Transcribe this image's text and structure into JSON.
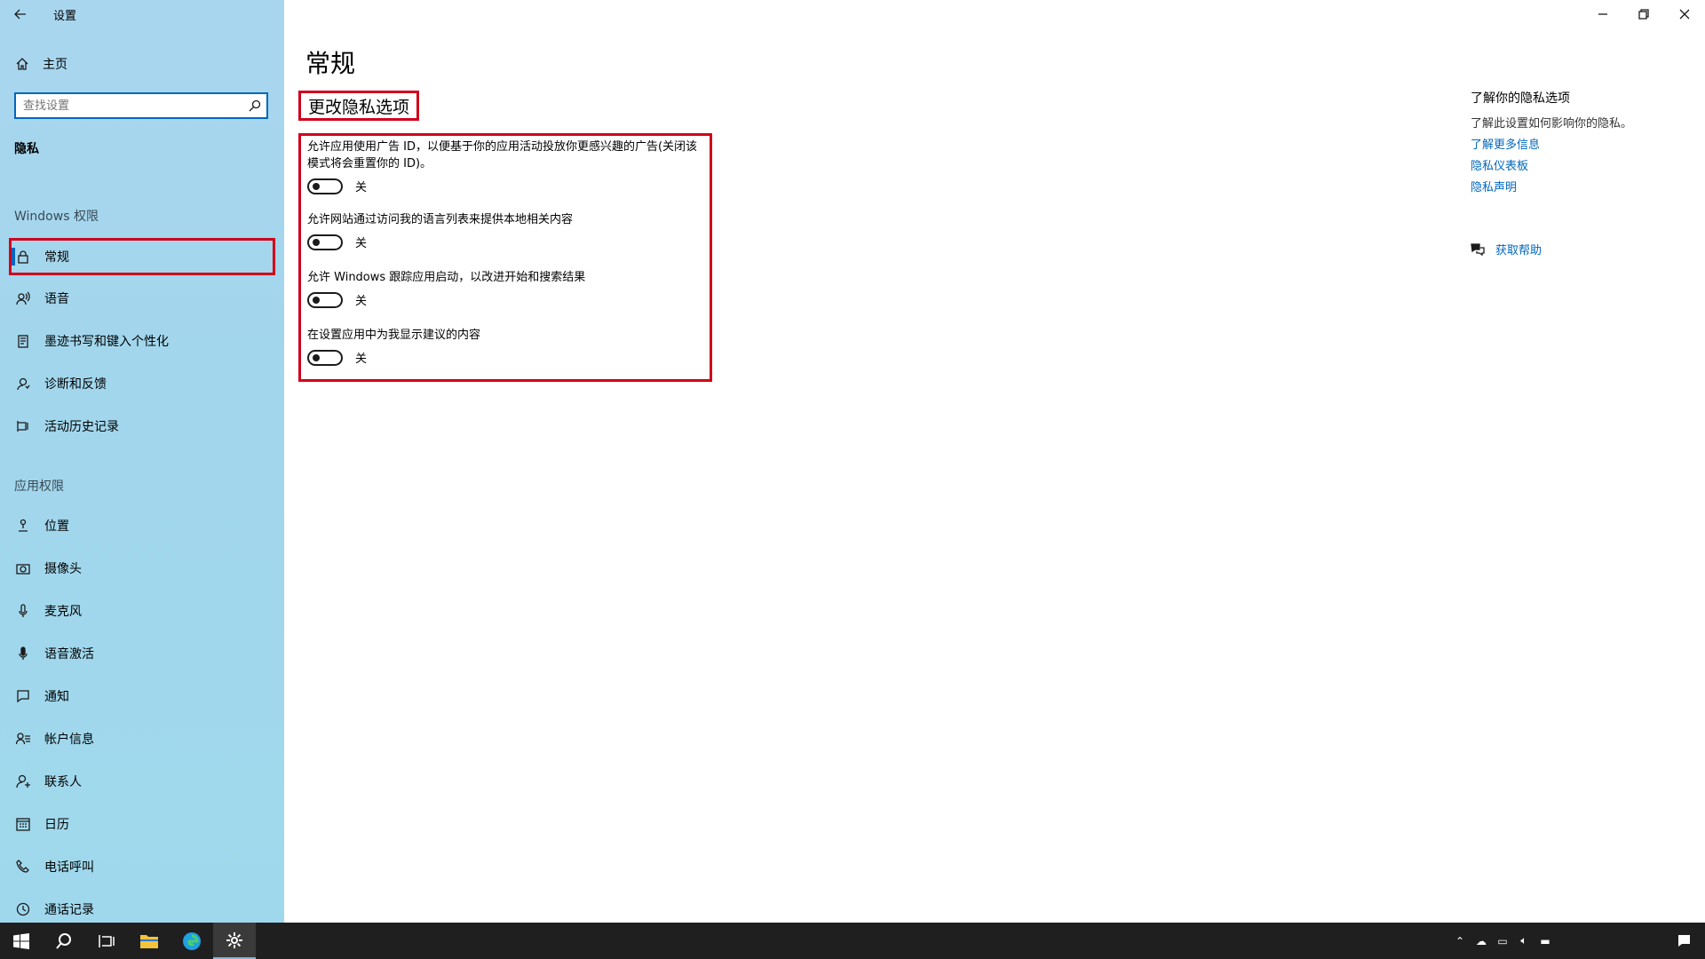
{
  "window": {
    "title": "设置",
    "accent": "#0067c0",
    "highlight": "#d0021b"
  },
  "sidebar": {
    "home_label": "主页",
    "search_placeholder": "查找设置",
    "section_label": "隐私",
    "groups": [
      {
        "title": "Windows 权限"
      },
      {
        "title": "应用权限"
      }
    ],
    "windows_items": [
      {
        "label": "常规",
        "icon": "lock-icon",
        "selected": true
      },
      {
        "label": "语音",
        "icon": "speech-icon"
      },
      {
        "label": "墨迹书写和键入个性化",
        "icon": "ink-icon"
      },
      {
        "label": "诊断和反馈",
        "icon": "feedback-icon"
      },
      {
        "label": "活动历史记录",
        "icon": "history-icon"
      }
    ],
    "app_items": [
      {
        "label": "位置",
        "icon": "location-icon"
      },
      {
        "label": "摄像头",
        "icon": "camera-icon"
      },
      {
        "label": "麦克风",
        "icon": "microphone-icon"
      },
      {
        "label": "语音激活",
        "icon": "voice-activation-icon"
      },
      {
        "label": "通知",
        "icon": "notification-icon"
      },
      {
        "label": "帐户信息",
        "icon": "account-icon"
      },
      {
        "label": "联系人",
        "icon": "contacts-icon"
      },
      {
        "label": "日历",
        "icon": "calendar-icon"
      },
      {
        "label": "电话呼叫",
        "icon": "phone-icon"
      },
      {
        "label": "通话记录",
        "icon": "call-history-icon"
      }
    ]
  },
  "main": {
    "page_title": "常规",
    "subtitle": "更改隐私选项",
    "options": [
      {
        "desc": "允许应用使用广告 ID，以便基于你的应用活动投放你更感兴趣的广告(关闭该模式将会重置你的 ID)。",
        "state": "关"
      },
      {
        "desc": "允许网站通过访问我的语言列表来提供本地相关内容",
        "state": "关"
      },
      {
        "desc": "允许 Windows 跟踪应用启动，以改进开始和搜索结果",
        "state": "关"
      },
      {
        "desc": "在设置应用中为我显示建议的内容",
        "state": "关"
      }
    ]
  },
  "right_panel": {
    "title": "了解你的隐私选项",
    "desc": "了解此设置如何影响你的隐私。",
    "links": [
      "了解更多信息",
      "隐私仪表板",
      "隐私声明"
    ],
    "help": "获取帮助"
  }
}
